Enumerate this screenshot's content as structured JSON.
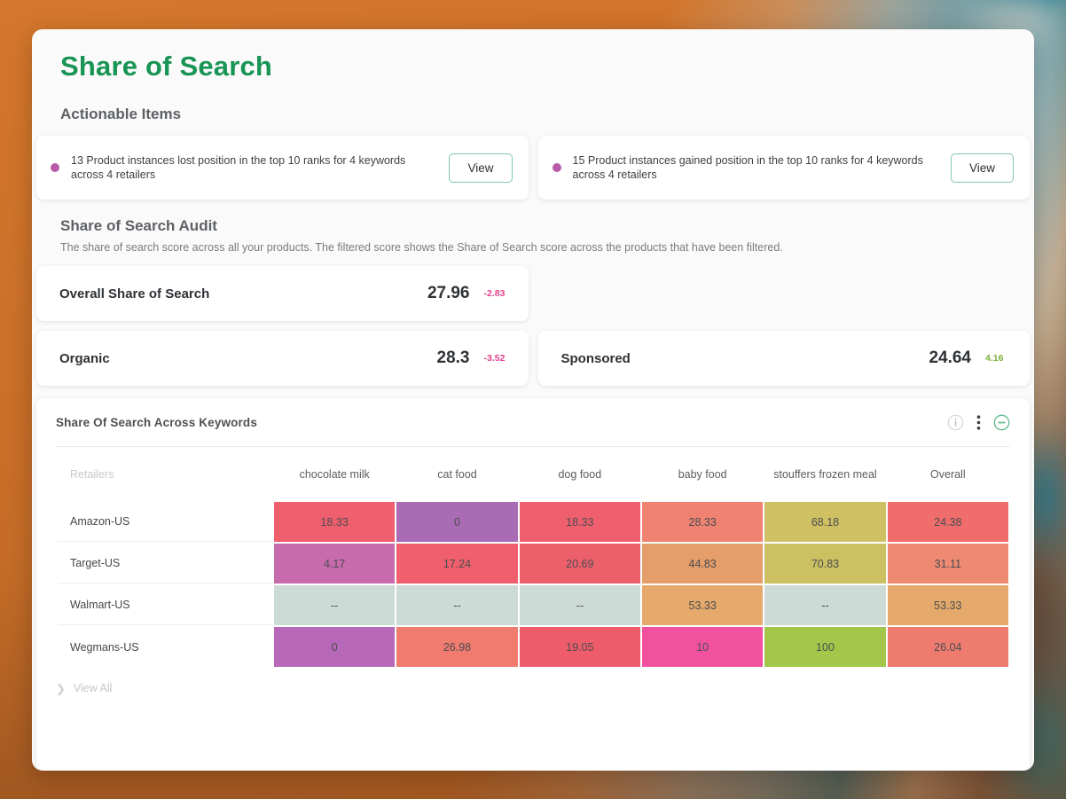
{
  "header": {
    "title": "Share of Search",
    "logo_name": "ACTOWIZ",
    "logo_tagline": "Application of Data & Insights",
    "logo_icon": "actowiz-a-logo-icon"
  },
  "actionable": {
    "section_title": "Actionable Items",
    "items": [
      {
        "text": "13 Product instances lost position in the top 10 ranks for 4 keywords across 4 retailers",
        "button_label": "View",
        "dot_color": "#b95aa8"
      },
      {
        "text": "15 Product instances gained position in the top 10 ranks for 4 keywords across 4 retailers",
        "button_label": "View",
        "dot_color": "#b95aa8"
      }
    ]
  },
  "audit": {
    "title": "Share of Search Audit",
    "description": "The share of search score across all your products. The filtered score shows the Share of Search score across the products that have been filtered.",
    "scores": [
      {
        "label": "Overall Share of Search",
        "value": "27.96",
        "delta": "-2.83",
        "direction": "down"
      },
      {
        "label": "",
        "value": "",
        "delta": "",
        "direction": "none"
      },
      {
        "label": "Organic",
        "value": "28.3",
        "delta": "-3.52",
        "direction": "down"
      },
      {
        "label": "Sponsored",
        "value": "24.64",
        "delta": "4.16",
        "direction": "up"
      }
    ],
    "delta_down_color": "#e2418f",
    "delta_up_color": "#79b23a"
  },
  "keywords_panel": {
    "title": "Share Of Search Across Keywords",
    "icons": [
      "info-icon",
      "more-vertical-icon",
      "minus-circle-icon"
    ],
    "footer_label": "View All",
    "footer_icon": "chevron-right-icon"
  },
  "chart_data": {
    "type": "heatmap",
    "title": "Share Of Search Across Keywords",
    "row_header": "Retailers",
    "categories": [
      "chocolate milk",
      "cat food",
      "dog food",
      "baby food",
      "stouffers frozen meal",
      "Overall"
    ],
    "rows": [
      {
        "name": "Amazon-US",
        "cells": [
          {
            "value": "18.33",
            "color": "#ef5f6d"
          },
          {
            "value": "0",
            "color": "#a96cb4"
          },
          {
            "value": "18.33",
            "color": "#ef5f6d"
          },
          {
            "value": "28.33",
            "color": "#ef8270"
          },
          {
            "value": "68.18",
            "color": "#cfc063"
          },
          {
            "value": "24.38",
            "color": "#ef6d6a"
          }
        ]
      },
      {
        "name": "Target-US",
        "cells": [
          {
            "value": "4.17",
            "color": "#c76bad"
          },
          {
            "value": "17.24",
            "color": "#ef5f6d"
          },
          {
            "value": "20.69",
            "color": "#ee5f6c"
          },
          {
            "value": "44.83",
            "color": "#e59e6a"
          },
          {
            "value": "70.83",
            "color": "#cdc062"
          },
          {
            "value": "31.11",
            "color": "#ef8a72"
          }
        ]
      },
      {
        "name": "Walmart-US",
        "cells": [
          {
            "value": "--",
            "color": "#cddbd6"
          },
          {
            "value": "--",
            "color": "#cddbd6"
          },
          {
            "value": "--",
            "color": "#cddbd6"
          },
          {
            "value": "53.33",
            "color": "#e5a96b"
          },
          {
            "value": "--",
            "color": "#cddbd6"
          },
          {
            "value": "53.33",
            "color": "#e5a96b"
          }
        ]
      },
      {
        "name": "Wegmans-US",
        "cells": [
          {
            "value": "0",
            "color": "#b768b8"
          },
          {
            "value": "26.98",
            "color": "#f07b6e"
          },
          {
            "value": "19.05",
            "color": "#ee5c6b"
          },
          {
            "value": "10",
            "color": "#f2519f"
          },
          {
            "value": "100",
            "color": "#a0c councils"
          },
          {
            "value": "26.04",
            "color": "#ef7a6e"
          }
        ]
      }
    ]
  }
}
